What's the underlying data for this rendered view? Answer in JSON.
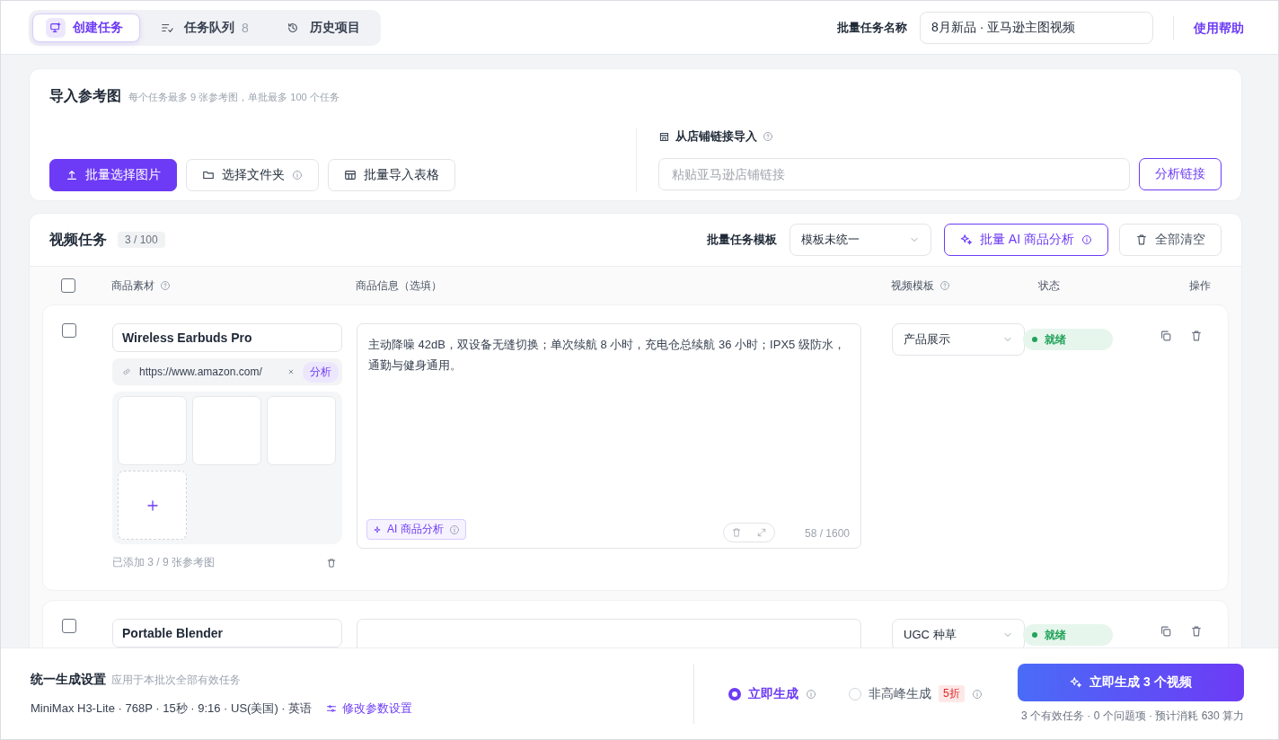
{
  "tabs": [
    {
      "label": "创建任务",
      "selected": true
    },
    {
      "label": "任务队列",
      "count": "8",
      "selected": false
    },
    {
      "label": "历史项目",
      "selected": false
    }
  ],
  "batch_name": {
    "label": "批量任务名称",
    "value": "8月新品 · 亚马逊主图视频"
  },
  "help_link": "使用帮助",
  "import": {
    "title": "导入参考图",
    "hint": "每个任务最多 9 张参考图，单批最多 100 个任务",
    "buttons": [
      {
        "label": "批量选择图片",
        "kind": "primary"
      },
      {
        "label": "选择文件夹",
        "kind": "folder"
      },
      {
        "label": "批量导入表格",
        "kind": "table"
      }
    ],
    "store": {
      "label": "从店铺链接导入",
      "placeholder": "粘贴亚马逊店铺链接",
      "button": "分析链接"
    }
  },
  "tasks_panel": {
    "title": "视频任务",
    "count": "3 / 100",
    "template_label": "批量任务模板",
    "template_value": "模板未统一",
    "ai_button": "批量 AI 商品分析",
    "clear_button": "全部清空",
    "columns": [
      "商品素材",
      "商品信息（选填）",
      "视频模板",
      "状态",
      "操作"
    ],
    "select_all_checked": false,
    "rows": [
      {
        "checked": false,
        "name": "Wireless Earbuds Pro",
        "url": "https://www.amazon.com/",
        "analyze": "分析",
        "thumbnails": [
          {
            "kind": "blank"
          },
          {
            "kind": "blank"
          },
          {
            "kind": "blank"
          }
        ],
        "added": "已添加 3 / 9 张参考图",
        "info": "主动降噪 42dB，双设备无缝切换；单次续航 8 小时，充电仓总续航 36 小时；IPX5 级防水，通勤与健身通用。",
        "ai_tag": "AI 商品分析",
        "counter": "58 / 1600",
        "template": "产品展示",
        "status": "就绪",
        "color": "#22a35a"
      },
      {
        "checked": false,
        "name": "Portable Blender",
        "template": "UGC 种草",
        "status": "就绪",
        "color": "#22a35a"
      }
    ]
  },
  "footer": {
    "title": "统一生成设置",
    "subtitle": "应用于本批次全部有效任务",
    "params": "MiniMax H3-Lite · 768P · 15秒 · 9:16 · US(美国) · 英语",
    "edit_link": "修改参数设置",
    "modes": [
      {
        "label": "立即生成",
        "selected": true
      },
      {
        "label": "非高峰生成",
        "badge": "5折",
        "selected": false
      }
    ],
    "generate_button": "立即生成 3 个视频",
    "summary": "3 个有效任务 · 0 个问题项 · 预计消耗 630 算力"
  }
}
